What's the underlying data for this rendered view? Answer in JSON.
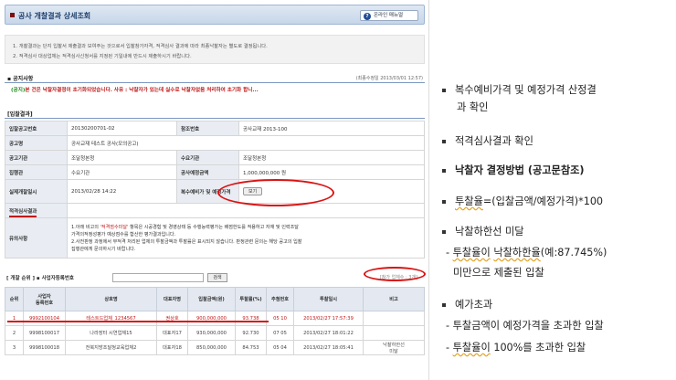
{
  "window": {
    "title": "공사 개찰결과 상세조회",
    "help_label": "온라인 매뉴얼"
  },
  "notice": {
    "line1": "1.  개찰결과는 단지 입찰서 제출결과 보여주는 것으로서 입찰참가자격, 적격심사 결과에 따라 최종낙찰자는 별도로 결정됩니다.",
    "line2": "2.  적격심사 대상업체는 적격심사신청서를 지정된 기일내에 반드시 제출하시기 바랍니다."
  },
  "notice_section": {
    "heading": "공지사항",
    "updated": "(최종수정일 2013/03/01 12:57)",
    "message_tag": "(공지)",
    "message": "본 건은 낙찰자결정이 초기화되었습니다. 사유 : 낙찰자가 있는데 실수로 낙찰자없음 처리하여 초기화 합니..."
  },
  "result_section": {
    "heading": "[입찰결과]"
  },
  "info": {
    "bid_no_label": "입찰공고번호",
    "bid_no": "20130200701-02",
    "ref_no_label": "참조번호",
    "ref_no": "공사교재 2013-100",
    "name_label": "공고명",
    "name": "공사교재 테스트 공사(모의공고)",
    "agency_label": "공고기관",
    "agency": "조달청본청",
    "demand_label": "수요기관",
    "demand": "조달청본청",
    "exec_label": "집행관",
    "exec": "수요기관",
    "budget_label": "공사예정금액",
    "budget": "1,000,000,000 원",
    "open_label": "실제개찰일시",
    "open": "2013/02/28 14:22",
    "multi_label": "복수예비가 및 예정가격",
    "multi_btn": "보기",
    "qual_label": "적격심사결과",
    "reason_label": "유의사항",
    "reason1_pre": "1.아래 비고의 ",
    "reason1_hl": "'적격점수미달'",
    "reason1_post": " 항목은 시공경험 및 경영상태 등 수행능력평가는 배점한도를 적용하고 자재 및 인력조달",
    "reason2": "가격의적정성평가 예상점수를 합산한 평가결과입니다.",
    "reason3": "2.사전판정 과정에서 부적격 처리된 업체의 투찰금액과 투찰률은 표시되지 않습니다. 판정관련 문의는 해당 공고의 입찰",
    "reason4": "집행관에게 문의하시기 바랍니다."
  },
  "search": {
    "label": "[ 개찰 순위 ]  ▪ 사업자등록번호",
    "btn": "검색",
    "count": "[참가 업체수 : 3개]"
  },
  "results": {
    "headers": [
      "순위",
      "사업자\n등록번호",
      "상호명",
      "대표자명",
      "입찰금액(원)",
      "투찰률(%)",
      "추첨번호",
      "투찰일시",
      "비고"
    ],
    "rows": [
      [
        "1",
        "9992100104",
        "테스트드업체_1234567",
        "권상호",
        "900,000,000",
        "93.738",
        "05 10",
        "2013/02/27 17:57:39",
        ""
      ],
      [
        "2",
        "9998100017",
        "나라장터 시연업체15",
        "대표자17",
        "930,000,000",
        "92.730",
        "07 05",
        "2013/02/27 18:01:22",
        ""
      ],
      [
        "3",
        "9998100018",
        "전북지방조달청교육업체2",
        "대표자18",
        "850,000,000",
        "84.753",
        "05 04",
        "2013/02/27 18:05:41",
        "낙찰하한선\n미달"
      ]
    ]
  },
  "bullets": {
    "b1a": "복수예비가격 및 예정가격 산정결",
    "b1b": "과 확인",
    "b2": "적격심사결과 확인",
    "b3": "낙찰자 결정방법 (공고문참조)",
    "b4_w": "투찰율",
    "b4_rest": "=(입찰금액/예정가격)*100",
    "b5": "낙찰하한선 미달",
    "b5s_pre": "- ",
    "b5s_w1": "투찰율이",
    "b5s_mid": " ",
    "b5s_w2": "낙찰하한율",
    "b5s_post": "(예:87.745%)",
    "b5c": "미만으로 제출된 입찰",
    "b6": "예가초과",
    "b6s1": "- 투찰금액이 예정가격을 초과한 입찰",
    "b6s2_pre": "- ",
    "b6s2_w": "투찰율이",
    "b6s2_post": " 100%를 초과한 입찰"
  }
}
